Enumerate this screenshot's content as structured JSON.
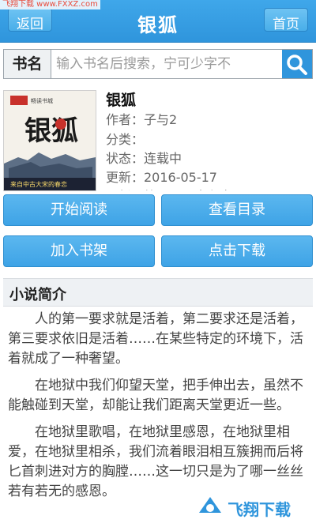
{
  "watermark": {
    "top_left": "飞翔下载 www.FXXZ.com",
    "bottom_right": "飞翔下载"
  },
  "header": {
    "back_label": "返回",
    "title": "银狐",
    "home_label": "首页"
  },
  "search": {
    "label": "书名",
    "placeholder": "输入书名后搜索，宁可少字不"
  },
  "cover": {
    "badge": "畅读书城",
    "calligraphy": "银狐",
    "tagline": "来自中古大宋的春恋"
  },
  "book": {
    "title": "银狐",
    "author": "作者：子与2",
    "category": "分类：",
    "status": "状态：连载中",
    "updated": "更新：2016-05-17",
    "latest": "最新：第三百二十九章 ..."
  },
  "actions": {
    "start_reading": "开始阅读",
    "view_catalog": "查看目录",
    "add_to_shelf": "加入书架",
    "download": "点击下载"
  },
  "intro": {
    "heading": "小说简介",
    "paragraphs": [
      "人的第一要求就是活着，第二要求还是活着，第三要求依旧是活着……在某些特定的环境下，活着就成了一种奢望。",
      "在地狱中我们仰望天堂，把手伸出去，虽然不能触碰到天堂，却能让我们距离天堂更近一些。",
      "在地狱里歌唱，在地狱里感恩，在地狱里相爱，在地狱里相杀，我们流着眼泪相互簇拥而后将匕首刺进对方的胸膛……这一切只是为了哪一丝丝若有若无的感恩。"
    ]
  },
  "colors": {
    "accent": "#2f95dc",
    "button": "#4aaee9"
  }
}
